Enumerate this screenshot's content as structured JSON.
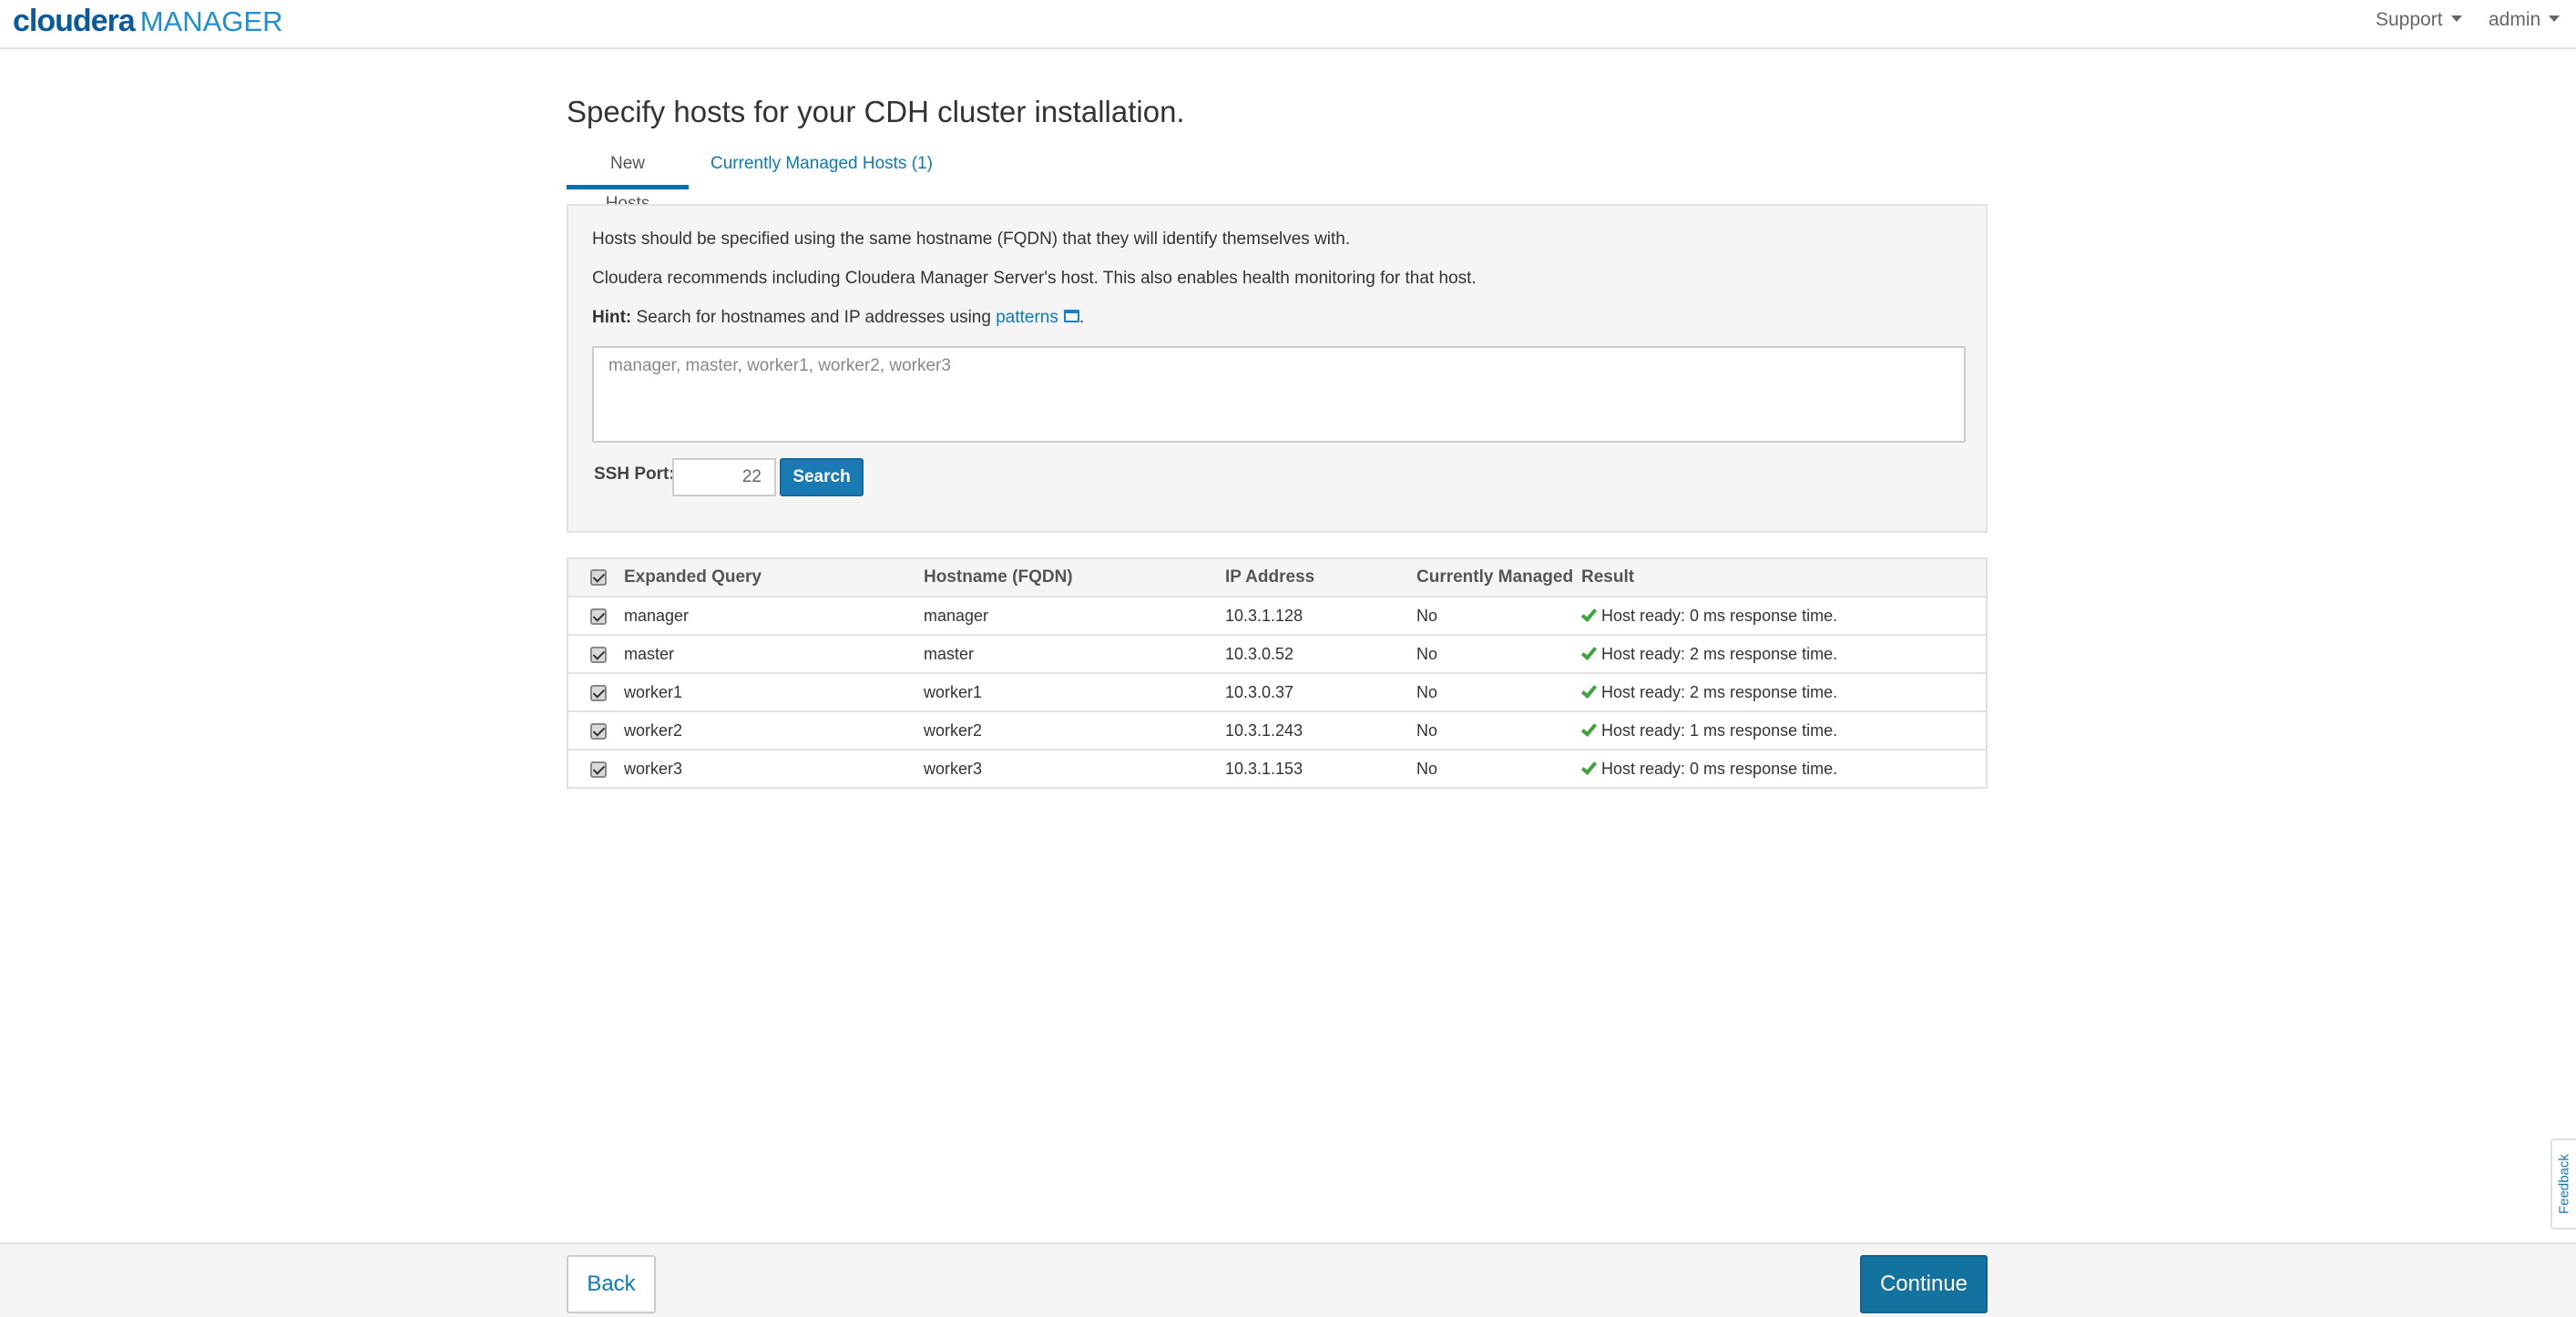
{
  "header": {
    "logo_primary": "cloudera",
    "logo_secondary": "MANAGER",
    "support_label": "Support",
    "admin_label": "admin"
  },
  "page": {
    "title": "Specify hosts for your CDH cluster installation."
  },
  "tabs": [
    {
      "label": "New Hosts",
      "active": true
    },
    {
      "label": "Currently Managed Hosts (1)",
      "active": false
    }
  ],
  "panel": {
    "line1": "Hosts should be specified using the same hostname (FQDN) that they will identify themselves with.",
    "line2": "Cloudera recommends including Cloudera Manager Server's host. This also enables health monitoring for that host.",
    "hint_label": "Hint:",
    "hint_text": " Search for hostnames and IP addresses using ",
    "hint_link": "patterns",
    "hint_end": ".",
    "hosts_placeholder": "manager, master, worker1, worker2, worker3",
    "ssh_port_label": "SSH Port:",
    "ssh_port_value": "22",
    "search_label": "Search"
  },
  "table": {
    "headers": [
      "Expanded Query",
      "Hostname (FQDN)",
      "IP Address",
      "Currently Managed",
      "Result"
    ],
    "rows": [
      {
        "query": "manager",
        "hostname": "manager",
        "ip": "10.3.1.128",
        "managed": "No",
        "result": "Host ready: 0 ms response time."
      },
      {
        "query": "master",
        "hostname": "master",
        "ip": "10.3.0.52",
        "managed": "No",
        "result": "Host ready: 2 ms response time."
      },
      {
        "query": "worker1",
        "hostname": "worker1",
        "ip": "10.3.0.37",
        "managed": "No",
        "result": "Host ready: 2 ms response time."
      },
      {
        "query": "worker2",
        "hostname": "worker2",
        "ip": "10.3.1.243",
        "managed": "No",
        "result": "Host ready: 1 ms response time."
      },
      {
        "query": "worker3",
        "hostname": "worker3",
        "ip": "10.3.1.153",
        "managed": "No",
        "result": "Host ready: 0 ms response time."
      }
    ]
  },
  "footer": {
    "back_label": "Back",
    "continue_label": "Continue"
  },
  "feedback_label": "Feedback",
  "colors": {
    "accent": "#1a7ab4",
    "success": "#3da33d"
  }
}
